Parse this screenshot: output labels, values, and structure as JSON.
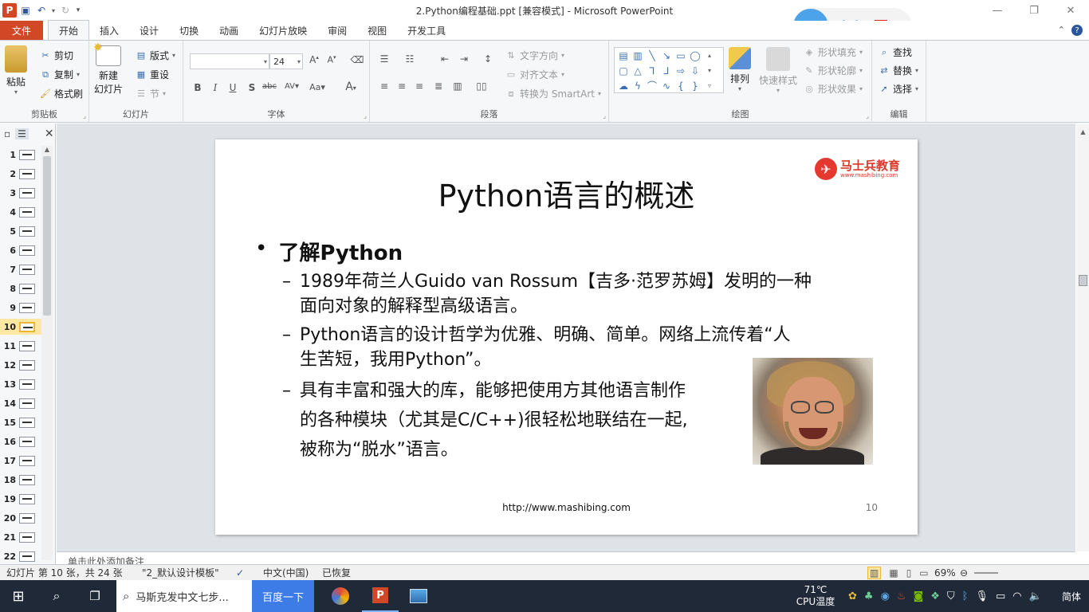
{
  "window": {
    "title": "2.Python编程基础.ppt [兼容模式] - Microsoft PowerPoint",
    "controls": [
      "—",
      "❐",
      "✕"
    ]
  },
  "recorder": {
    "timer": "00:00"
  },
  "qat": {
    "app_icon": "P"
  },
  "tabs": {
    "file": "文件",
    "items": [
      "开始",
      "插入",
      "设计",
      "切换",
      "动画",
      "幻灯片放映",
      "审阅",
      "视图",
      "开发工具"
    ],
    "active": "开始"
  },
  "ribbon": {
    "clipboard": {
      "paste": "粘贴",
      "cut": "剪切",
      "copy": "复制",
      "format_painter": "格式刷",
      "label": "剪贴板"
    },
    "slides": {
      "new_slide_1": "新建",
      "new_slide_2": "幻灯片",
      "layout": "版式",
      "reset": "重设",
      "section": "节",
      "label": "幻灯片"
    },
    "font": {
      "font_name": "",
      "font_size": "24",
      "label": "字体"
    },
    "paragraph": {
      "text_direction": "文字方向",
      "align_text": "对齐文本",
      "smartart": "转换为 SmartArt",
      "label": "段落"
    },
    "drawing": {
      "arrange": "排列",
      "quick_styles": "快速样式",
      "shape_fill": "形状填充",
      "shape_outline": "形状轮廓",
      "shape_effects": "形状效果",
      "label": "绘图"
    },
    "editing": {
      "find": "查找",
      "replace": "替换",
      "select": "选择",
      "label": "编辑"
    }
  },
  "thumbnails": {
    "numbers": [
      "1",
      "2",
      "3",
      "4",
      "5",
      "6",
      "7",
      "8",
      "9",
      "10",
      "11",
      "12",
      "13",
      "14",
      "15",
      "16",
      "17",
      "18",
      "19",
      "20",
      "21",
      "22"
    ],
    "selected": "10"
  },
  "slide": {
    "title": "Python语言的概述",
    "logo_name": "马士兵教育",
    "logo_url": "www.mashibing.com",
    "bullet_main": "了解Python",
    "sub_bullets": [
      {
        "line1": "1989年荷兰人Guido van Rossum【吉多·范罗苏姆】发明的一种",
        "line2": "面向对象的解释型高级语言。"
      },
      {
        "line1": "Python语言的设计哲学为优雅、明确、简单。网络上流传着“人",
        "line2": "生苦短，我用Python”。"
      },
      {
        "line1": "具有丰富和强大的库，能够把使用方其他语言制作",
        "line2": "的各种模块（尤其是C/C++)很轻松地联结在一起,",
        "line3": "被称为“脱水”语言。"
      }
    ],
    "footer_url": "http://www.mashibing.com",
    "page_number": "10"
  },
  "notes": {
    "text": "单击此处添加备注"
  },
  "status": {
    "slide_info": "幻灯片 第 10 张，共 24 张",
    "theme": "\"2_默认设计模板\"",
    "language": "中文(中国)",
    "recovered": "已恢复",
    "zoom": "69%"
  },
  "taskbar": {
    "search_text": "马斯克发中文七步...",
    "search_button": "百度一下",
    "temperature": "71℃",
    "cpu_label": "CPU温度",
    "ime": "简体"
  },
  "colors": {
    "file_tab": "#d24726",
    "recorder": "#4da3ea",
    "stop": "#e0202a",
    "brand": "#e5382f",
    "taskbar": "#1f2937"
  }
}
